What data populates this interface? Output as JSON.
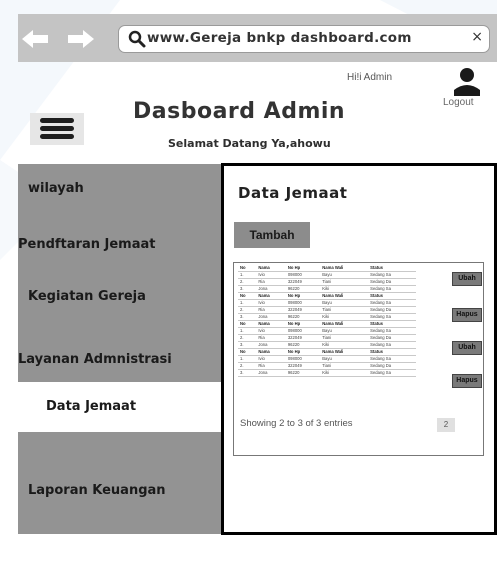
{
  "browser": {
    "url": "www.Gereja bnkp dashboard.com",
    "back_icon": "left-arrow-icon",
    "forward_icon": "right-arrow-icon",
    "close": "×"
  },
  "header": {
    "greeting": "Hi!i Admin",
    "logout": "Logout",
    "title": "Dasboard Admin",
    "subtitle": "Selamat Datang Ya,ahowu"
  },
  "sidebar": {
    "items": [
      {
        "label": "wilayah"
      },
      {
        "label": "Pendftaran Jemaat"
      },
      {
        "label": "Kegiatan Gereja"
      },
      {
        "label": "Layanan Admnistrasi"
      },
      {
        "label": "Data Jemaat"
      },
      {
        "label": "Laporan Keuangan"
      }
    ]
  },
  "main": {
    "title": "Data Jemaat",
    "add_button": "Tambah",
    "table": {
      "columns": [
        "No",
        "Nama",
        "No Hp",
        "Nama Wali",
        "Status"
      ],
      "rows": [
        [
          "No",
          "Nama",
          "No Hp",
          "Nama Wali",
          "Status"
        ],
        [
          "1.",
          "Ivio",
          "098000",
          "Bayu",
          "Sedang Sa"
        ],
        [
          "2.",
          "Ria",
          "322049",
          "Tiani",
          "Sedang Da"
        ],
        [
          "3.",
          "Jona",
          "96220",
          "Kiki",
          "Sedang Sa"
        ],
        [
          "No",
          "Nama",
          "No Hp",
          "Nama Wali",
          "Status"
        ],
        [
          "1.",
          "Ivio",
          "098000",
          "Bayu",
          "Sedang Sa"
        ],
        [
          "2.",
          "Ria",
          "322049",
          "Tiani",
          "Sedang Da"
        ],
        [
          "3.",
          "Jona",
          "96220",
          "Kiki",
          "Sedang Sa"
        ],
        [
          "No",
          "Nama",
          "No Hp",
          "Nama Wali",
          "Status"
        ],
        [
          "1.",
          "Ivio",
          "098000",
          "Bayu",
          "Sedang Sa"
        ],
        [
          "2.",
          "Ria",
          "322049",
          "Tiani",
          "Sedang Da"
        ],
        [
          "3.",
          "Jona",
          "96220",
          "Kiki",
          "Sedang Sa"
        ],
        [
          "No",
          "Nama",
          "No Hp",
          "Nama Wali",
          "Status"
        ],
        [
          "1.",
          "Ivio",
          "098000",
          "Bayu",
          "Sedang Sa"
        ],
        [
          "2.",
          "Ria",
          "322049",
          "Tiani",
          "Sedang Da"
        ],
        [
          "3.",
          "Jona",
          "96220",
          "Kiki",
          "Sedang Sa"
        ]
      ]
    },
    "row_buttons": [
      "Ubah",
      "Hapus",
      "Ubah",
      "Hapus"
    ],
    "showing": "Showing 2 to  3 of 3 entries",
    "page": "2"
  },
  "colors": {
    "browser_bar": "#c4c4c4",
    "sidebar": "#939393",
    "button": "#8c8c8c",
    "border": "#000000"
  }
}
